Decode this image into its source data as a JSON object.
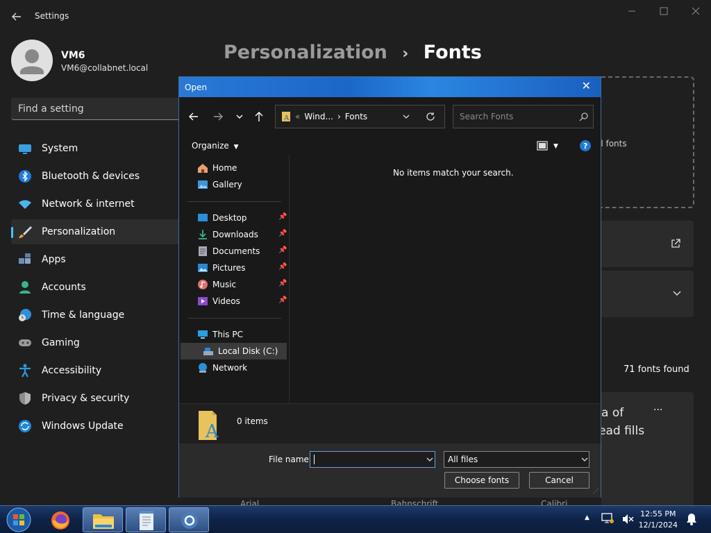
{
  "window": {
    "title": "Settings"
  },
  "user": {
    "name": "VM6",
    "email": "VM6@collabnet.local"
  },
  "search": {
    "placeholder": "Find a setting"
  },
  "sidebar": {
    "items": [
      {
        "label": "System",
        "icon": "system-icon"
      },
      {
        "label": "Bluetooth & devices",
        "icon": "bluetooth-icon"
      },
      {
        "label": "Network & internet",
        "icon": "wifi-icon"
      },
      {
        "label": "Personalization",
        "icon": "brush-icon",
        "selected": true
      },
      {
        "label": "Apps",
        "icon": "apps-icon"
      },
      {
        "label": "Accounts",
        "icon": "person-icon"
      },
      {
        "label": "Time & language",
        "icon": "globe-clock-icon"
      },
      {
        "label": "Gaming",
        "icon": "gamepad-icon"
      },
      {
        "label": "Accessibility",
        "icon": "accessibility-icon"
      },
      {
        "label": "Privacy & security",
        "icon": "shield-icon"
      },
      {
        "label": "Windows Update",
        "icon": "update-icon"
      }
    ]
  },
  "page": {
    "breadcrumb_parent": "Personalization",
    "breadcrumb_sep": "›",
    "breadcrumb_current": "Fonts"
  },
  "background": {
    "drop_text": "ll fonts",
    "fonts_found": "71 fonts found",
    "preview_line1": "a of",
    "preview_line2": "ead fills",
    "more": "···",
    "font_labels": [
      "Arial",
      "Bahnschrift",
      "Calibri"
    ]
  },
  "dialog": {
    "title": "Open",
    "close": "✕",
    "address": {
      "prefix": "«",
      "crumb1": "Wind...",
      "sep": "›",
      "crumb2": "Fonts"
    },
    "search_placeholder": "Search Fonts",
    "organize": "Organize",
    "empty_message": "No items match your search.",
    "nav": {
      "quick": [
        {
          "label": "Home"
        },
        {
          "label": "Gallery"
        }
      ],
      "pinned": [
        {
          "label": "Desktop"
        },
        {
          "label": "Downloads"
        },
        {
          "label": "Documents"
        },
        {
          "label": "Pictures"
        },
        {
          "label": "Music"
        },
        {
          "label": "Videos"
        }
      ],
      "this_pc": "This PC",
      "local_disk": "Local Disk (C:)",
      "network": "Network"
    },
    "status": "0 items",
    "file_name_label": "File name:",
    "file_name_value": "",
    "file_type": "All files",
    "primary_button": "Choose fonts",
    "cancel_button": "Cancel"
  },
  "taskbar": {
    "time": "12:55 PM",
    "date": "12/1/2024"
  }
}
